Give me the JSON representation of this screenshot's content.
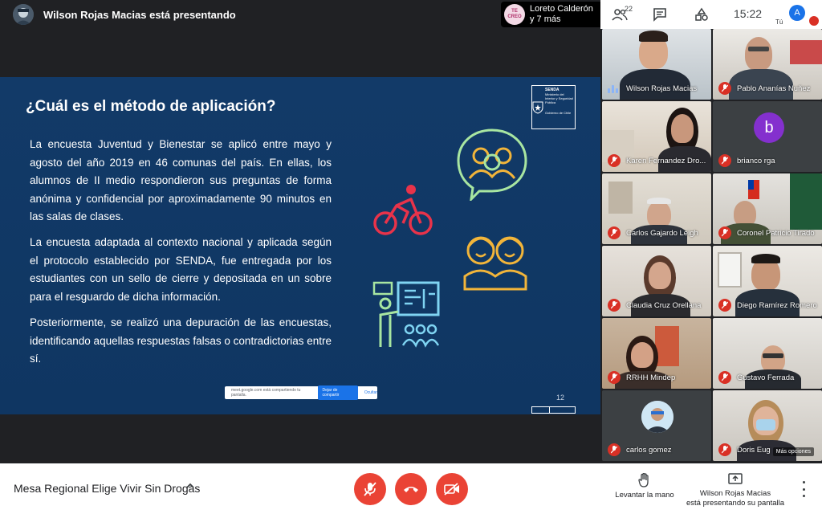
{
  "top_bar": {
    "presenter_status": "Wilson Rojas Macias está presentando",
    "pinned_name": "Loreto Calderón",
    "pinned_more": "y 7 más",
    "pinned_thumb_text": "TE CREO",
    "participants_count": "22",
    "time": "15:22",
    "self_initial": "A",
    "self_label": "Tú"
  },
  "slide": {
    "title": "¿Cuál es el método de aplicación?",
    "paragraphs": [
      "La encuesta Juventud y Bienestar se aplicó entre mayo y agosto del año 2019 en 46 comunas del país. En ellas, los alumnos de II medio respondieron sus preguntas de forma anónima y confidencial por aproximadamente 90 minutos en las salas de clases.",
      "La encuesta adaptada al contexto nacional y aplicada según el protocolo establecido por SENDA, fue entregada por los estudiantes con un sello de cierre y depositada en un sobre para el resguardo de dicha información.",
      "Posteriormente, se realizó una depuración de las encuestas, identificando aquellas respuestas falsas o contradictorias entre sí."
    ],
    "seal_lines": [
      "SENDA",
      "Ministerio del Interior y Seguridad Pública",
      "Gobierno de Chile"
    ],
    "share_notice": "meet.google.com está compartiendo tu pantalla.",
    "share_stop": "Dejar de compartir",
    "share_hide": "Ocultar",
    "page_number": "12",
    "colors": {
      "background": "#123a68",
      "icon_yellow": "#f2b53a",
      "icon_green": "#a8e6a1",
      "icon_red": "#e8334a",
      "icon_cyan": "#7fd4f2"
    }
  },
  "participants": [
    {
      "name": "Wilson Rojas Macias",
      "muted": false,
      "speaking": true
    },
    {
      "name": "Pablo Ananías Nuñez",
      "muted": true
    },
    {
      "name": "Karen Fernandez Dro...",
      "muted": true
    },
    {
      "name": "brianco rga",
      "muted": true,
      "initial": "b"
    },
    {
      "name": "Carlos Gajardo Leigh",
      "muted": true
    },
    {
      "name": "Coronel Patricio Tirado",
      "muted": true
    },
    {
      "name": "Claudia Cruz Orellana",
      "muted": true
    },
    {
      "name": "Diego Ramírez Romero",
      "muted": true
    },
    {
      "name": "RRHH Mindep",
      "muted": true
    },
    {
      "name": "Gustavo Ferrada",
      "muted": true
    },
    {
      "name": "carlos gomez",
      "muted": true
    },
    {
      "name": "Doris Eug",
      "muted": true,
      "more_options": "Más opciones"
    }
  ],
  "bottom_bar": {
    "meeting_name": "Mesa Regional Elige Vivir Sin Drogas",
    "raise_hand_label": "Levantar la mano",
    "presenting_line1": "Wilson Rojas Macias",
    "presenting_line2": "está presentando su pantalla"
  }
}
